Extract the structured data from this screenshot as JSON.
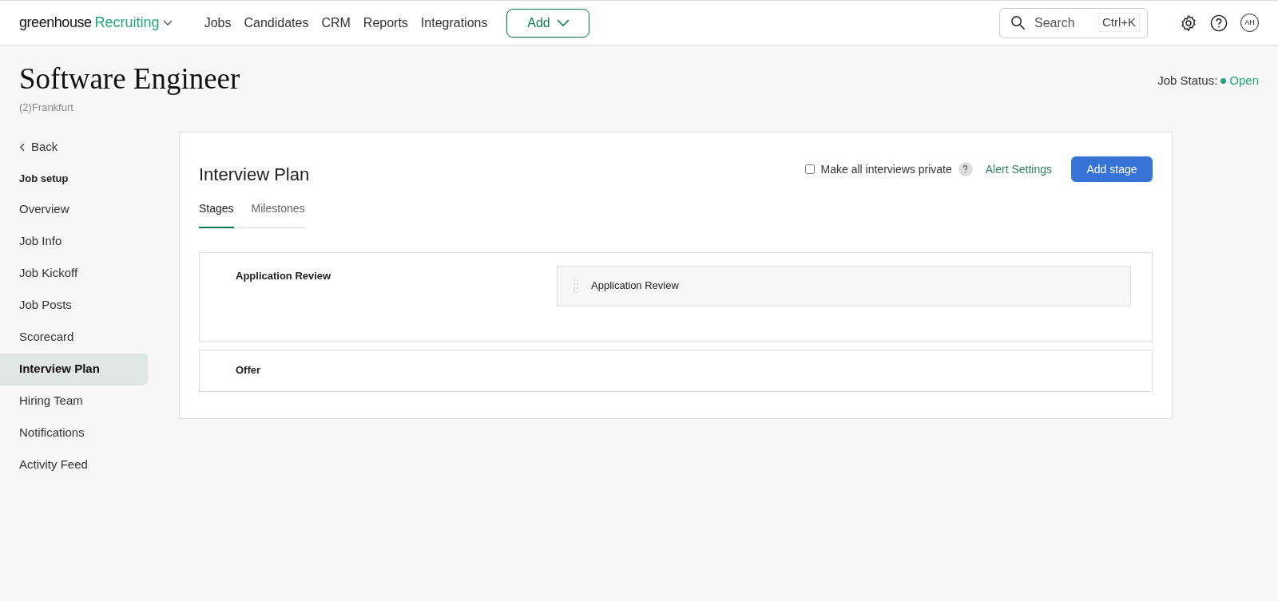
{
  "top_nav": {
    "logo": {
      "brand": "greenhouse",
      "product": "Recruiting"
    },
    "links": [
      {
        "label": "Jobs"
      },
      {
        "label": "Candidates"
      },
      {
        "label": "CRM"
      },
      {
        "label": "Reports"
      },
      {
        "label": "Integrations"
      }
    ],
    "add_button": "Add",
    "search": {
      "placeholder": "Search",
      "shortcut": "Ctrl+K"
    },
    "avatar": "AH"
  },
  "job": {
    "title": "Software Engineer",
    "location": "(2)Frankfurt",
    "status_label": "Job Status:",
    "status": "Open"
  },
  "sidebar": {
    "back": "Back",
    "section": "Job setup",
    "items": [
      {
        "label": "Overview",
        "selected": false
      },
      {
        "label": "Job Info",
        "selected": false
      },
      {
        "label": "Job Kickoff",
        "selected": false
      },
      {
        "label": "Job Posts",
        "selected": false
      },
      {
        "label": "Scorecard",
        "selected": false
      },
      {
        "label": "Interview Plan",
        "selected": true
      },
      {
        "label": "Hiring Team",
        "selected": false
      },
      {
        "label": "Notifications",
        "selected": false
      },
      {
        "label": "Activity Feed",
        "selected": false
      }
    ]
  },
  "interview_plan": {
    "title": "Interview Plan",
    "private_checkbox": {
      "label": "Make all interviews private",
      "checked": false
    },
    "alert_settings": "Alert Settings",
    "add_stage": "Add stage",
    "tabs": [
      {
        "label": "Stages",
        "selected": true
      },
      {
        "label": "Milestones",
        "selected": false
      }
    ],
    "stages": [
      {
        "name": "Application Review",
        "interviews": [
          "Application Review"
        ]
      },
      {
        "name": "Offer"
      }
    ]
  }
}
